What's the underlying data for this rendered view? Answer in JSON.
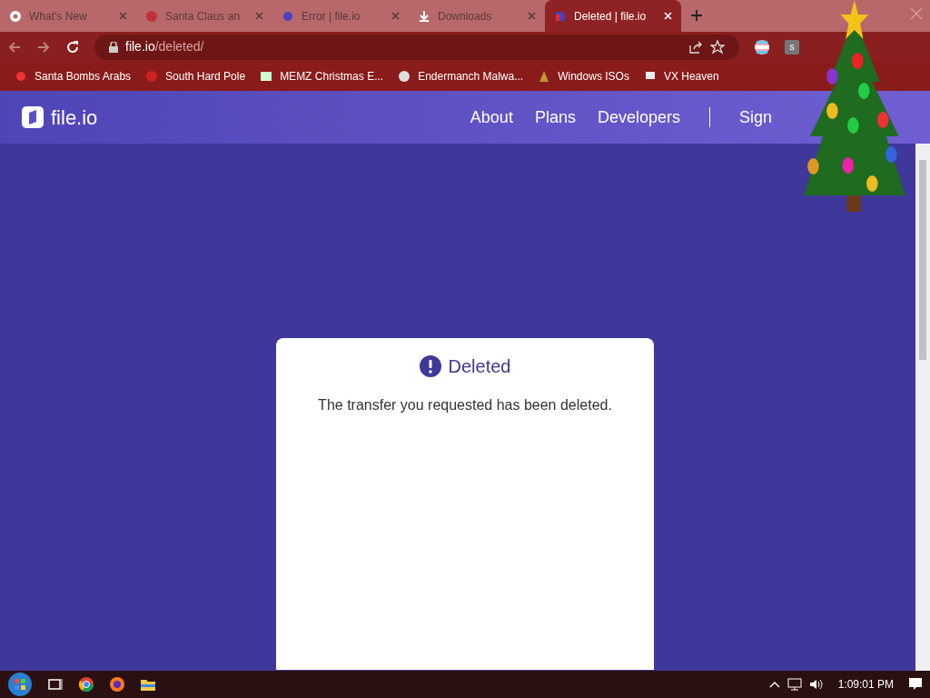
{
  "browser": {
    "tabs": [
      {
        "title": "What's New",
        "selected": false
      },
      {
        "title": "Santa Claus an",
        "selected": false
      },
      {
        "title": "Error | file.io",
        "selected": false
      },
      {
        "title": "Downloads",
        "selected": false
      },
      {
        "title": "Deleted | file.io",
        "selected": true
      }
    ],
    "address": {
      "host": "file.io",
      "path": "/deleted/"
    },
    "bookmarks": [
      {
        "label": "Santa Bombs Arabs"
      },
      {
        "label": "South Hard Pole"
      },
      {
        "label": "MEMZ Christmas E..."
      },
      {
        "label": "Endermanch Malwa..."
      },
      {
        "label": "Windows ISOs"
      },
      {
        "label": "VX Heaven"
      }
    ],
    "extension_badge": "s"
  },
  "site": {
    "logo": "file.io",
    "nav": [
      {
        "label": "About"
      },
      {
        "label": "Plans"
      },
      {
        "label": "Developers"
      },
      {
        "label": "Sign"
      }
    ]
  },
  "card": {
    "title": "Deleted",
    "message": "The transfer you requested has been deleted."
  },
  "taskbar": {
    "clock": "1:09:01 PM"
  }
}
